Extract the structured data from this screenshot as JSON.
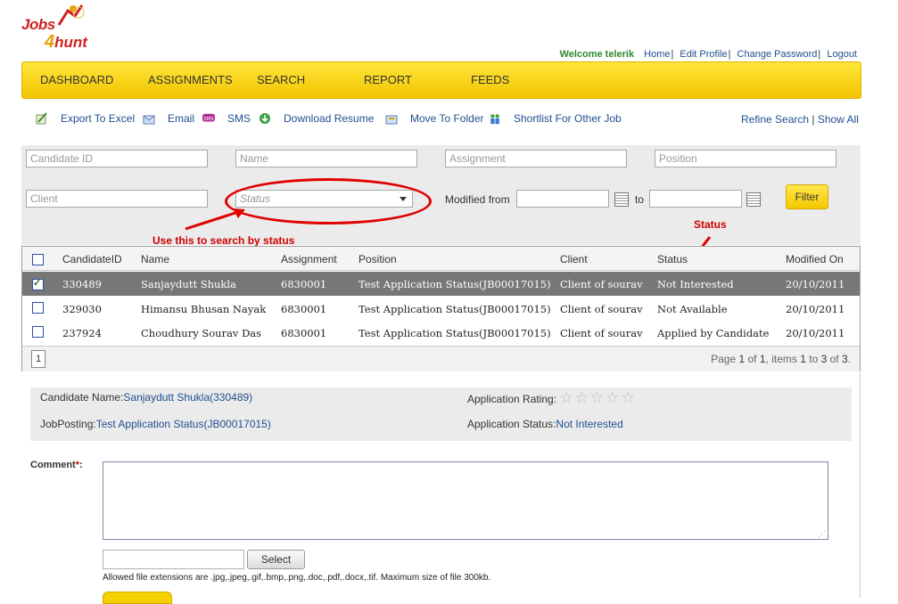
{
  "logo": {
    "text1": "Jobs",
    "text2_four": "4",
    "text2": "hunt"
  },
  "toplinks": {
    "welcome": "Welcome telerik",
    "items": [
      "Home",
      "Edit Profile",
      "Change Password",
      "Logout"
    ],
    "sep": "|"
  },
  "nav": [
    "DASHBOARD",
    "ASSIGNMENTS",
    "SEARCH",
    "REPORT",
    "FEEDS"
  ],
  "toolbar": {
    "items": [
      {
        "label": "Export To Excel",
        "icon": "excel-icon"
      },
      {
        "label": "Email",
        "icon": "email-icon"
      },
      {
        "label": "SMS",
        "icon": "sms-icon"
      },
      {
        "label": "Download Resume",
        "icon": "download-icon"
      },
      {
        "label": "Move To Folder",
        "icon": "folder-icon"
      },
      {
        "label": "Shortlist For Other Job",
        "icon": "users-icon"
      }
    ],
    "refine": "Refine Search",
    "sep": "|",
    "show_all": "Show All"
  },
  "filter": {
    "candidate_id": "Candidate ID",
    "name": "Name",
    "assignment": "Assignment",
    "position": "Position",
    "client": "Client",
    "status": "Status",
    "modified_from": "Modified from",
    "to": "to",
    "filter_btn": "Filter"
  },
  "annotations": {
    "note1": "Use this to search by status",
    "note2": "Status"
  },
  "grid": {
    "headers": [
      "CandidateID",
      "Name",
      "Assignment",
      "Position",
      "Client",
      "Status",
      "Modified On"
    ],
    "rows": [
      {
        "id": "330489",
        "name": "Sanjaydutt Shukla",
        "assignment": "6830001",
        "position": "Test Application Status(JB00017015)",
        "client": "Client of sourav",
        "status": "Not Interested",
        "modified": "20/10/2011",
        "selected": true
      },
      {
        "id": "329030",
        "name": "Himansu Bhusan Nayak",
        "assignment": "6830001",
        "position": "Test Application Status(JB00017015)",
        "client": "Client of sourav",
        "status": "Not Available",
        "modified": "20/10/2011",
        "selected": false
      },
      {
        "id": "237924",
        "name": "Choudhury Sourav Das",
        "assignment": "6830001",
        "position": "Test Application Status(JB00017015)",
        "client": "Client of sourav",
        "status": "Applied by Candidate",
        "modified": "20/10/2011",
        "selected": false
      }
    ],
    "page_num": "1",
    "pager_text": {
      "a": "Page ",
      "b": "1",
      "c": " of ",
      "d": "1",
      "e": ", items ",
      "f": "1",
      "g": " to ",
      "h": "3",
      "i": " of ",
      "j": "3",
      "k": "."
    }
  },
  "detail": {
    "cand_label": "Candidate Name:",
    "cand_value": "Sanjaydutt Shukla(330489)",
    "job_label": "JobPosting:",
    "job_value": "Test Application Status(JB00017015)",
    "rating_label": "Application Rating:",
    "rating": 0,
    "rating_max": 5,
    "status_label": "Application Status:",
    "status_value": "Not Interested"
  },
  "comment": {
    "label": "Comment",
    "required": "*",
    "colon": ":"
  },
  "upload": {
    "select_btn": "Select",
    "info": "Allowed file extensions are .jpg,.jpeg,.gif,.bmp,.png,.doc,.pdf,.docx,.tif. Maximum size of file 300kb."
  },
  "colors": {
    "nav_yellow": "#f5ce00",
    "annotation_red": "#e00000",
    "link_blue": "#1f4f8f",
    "welcome_green": "#2e8b2e",
    "selected_row": "#777777"
  }
}
